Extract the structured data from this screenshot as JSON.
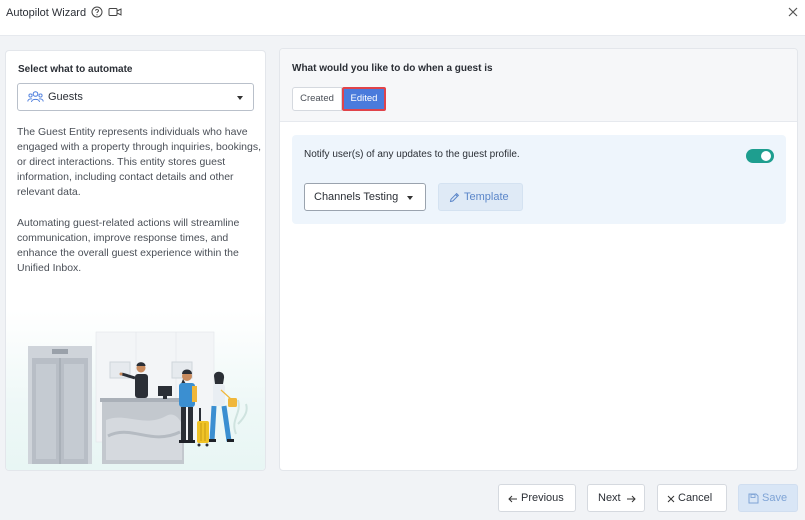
{
  "titlebar": {
    "title": "Autopilot Wizard",
    "icons": [
      "help-circle-icon",
      "video-camera-icon",
      "close-icon"
    ]
  },
  "left_panel": {
    "label": "Select what to automate",
    "select": {
      "value": "Guests",
      "icon": "group-users-icon"
    },
    "paragraph_1": "The Guest Entity represents individuals who have engaged with a property through inquiries, bookings, or direct interactions. This entity stores guest information, including contact details and other relevant data.",
    "paragraph_2": "Automating guest-related actions will streamline communication, improve response times, and enhance the overall guest experience within the Unified Inbox."
  },
  "right_panel": {
    "question": "What would you like to do when a guest is",
    "segments": [
      {
        "label": "Created",
        "selected": false
      },
      {
        "label": "Edited",
        "selected": true
      }
    ],
    "notify": {
      "text": "Notify user(s) of any updates to the guest profile.",
      "enabled": true,
      "channel_select": "Channels Testing",
      "template_button": "Template"
    }
  },
  "footer": {
    "previous": "Previous",
    "next": "Next",
    "cancel": "Cancel",
    "save": "Save"
  },
  "colors": {
    "accent": "#4a7bdc",
    "selected_outline": "#e0434a",
    "toggle_on": "#1e9e8f",
    "notify_bg": "#eef5fc",
    "save_disabled": "#d9e6f6"
  }
}
